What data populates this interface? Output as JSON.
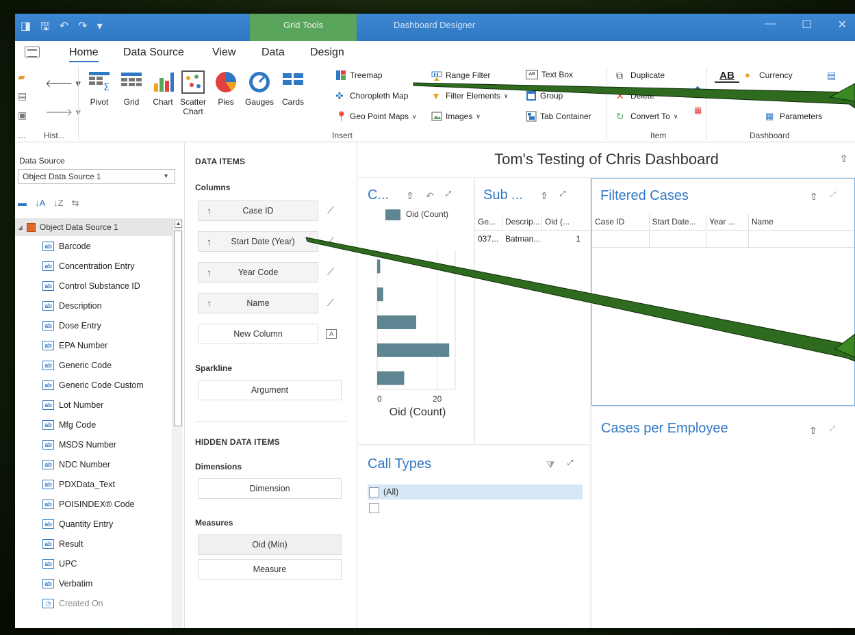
{
  "titlebar": {
    "context_tab": "Grid Tools",
    "title": "Dashboard Designer"
  },
  "tabs": [
    "Home",
    "Data Source",
    "View",
    "Data",
    "Design"
  ],
  "ribbon": {
    "history_group": "Hist...",
    "insert_group": "Insert",
    "item_group": "Item",
    "dashboard_group": "Dashboard",
    "big_buttons": {
      "pivot": "Pivot",
      "grid": "Grid",
      "chart": "Chart",
      "scatter_line1": "Scatter",
      "scatter_line2": "Chart",
      "pies": "Pies",
      "gauges": "Gauges",
      "cards": "Cards"
    },
    "small_buttons": {
      "treemap": "Treemap",
      "choropleth": "Choropleth Map",
      "geo_point": "Geo Point Maps",
      "range_filter": "Range Filter",
      "filter_elements": "Filter Elements",
      "images": "Images",
      "text_box": "Text Box",
      "group": "Group",
      "tab_container": "Tab Container",
      "duplicate": "Duplicate",
      "delete": "Delete",
      "convert_to": "Convert To",
      "title": "Title",
      "title_icon": "AB",
      "currency": "Currency",
      "parameters": "Parameters"
    }
  },
  "data_source": {
    "label": "Data Source",
    "selected": "Object Data Source 1",
    "root": "Object Data Source 1",
    "fields": [
      "Barcode",
      "Concentration Entry",
      "Control Substance ID",
      "Description",
      "Dose Entry",
      "EPA Number",
      "Generic Code",
      "Generic Code Custom",
      "Lot Number",
      "Mfg Code",
      "MSDS Number",
      "NDC Number",
      "PDXData_Text",
      "POISINDEX® Code",
      "Quantity Entry",
      "Result",
      "UPC",
      "Verbatim"
    ],
    "last_field": "Created On"
  },
  "data_items": {
    "header": "DATA ITEMS",
    "columns_label": "Columns",
    "columns": [
      "Case ID",
      "Start Date (Year)",
      "Year Code",
      "Name"
    ],
    "new_column": "New Column",
    "sparkline_label": "Sparkline",
    "sparkline_arg": "Argument",
    "hidden_header": "HIDDEN DATA ITEMS",
    "dimensions_label": "Dimensions",
    "dimension": "Dimension",
    "measures_label": "Measures",
    "measures": [
      "Oid (Min)",
      "Measure"
    ]
  },
  "dashboard": {
    "title": "Tom's Testing of Chris Dashboard",
    "chart_card": {
      "title": "C...",
      "legend": "Oid (Count)",
      "axis_title": "Oid (Count)",
      "ticks": [
        "0",
        "20"
      ]
    },
    "sub_card": {
      "title": "Sub ...",
      "headers": [
        "Ge...",
        "Descrip...",
        "Oid (..."
      ],
      "row": [
        "037...",
        "Batman...",
        "1"
      ]
    },
    "filtered": {
      "title": "Filtered Cases",
      "headers": [
        "Case ID",
        "Start Date...",
        "Year ...",
        "Name"
      ]
    },
    "cases_per_employee": {
      "title": "Cases per Employee"
    },
    "call_types": {
      "title": "Call Types",
      "all": "(All)"
    }
  },
  "chart_data": {
    "type": "bar",
    "orientation": "horizontal",
    "categories": [
      "",
      "",
      "",
      "",
      ""
    ],
    "series": [
      {
        "name": "Oid (Count)",
        "values": [
          1,
          2,
          13,
          24,
          9
        ]
      }
    ],
    "xlabel": "Oid (Count)",
    "xlim": [
      0,
      26
    ],
    "xticks": [
      0,
      20
    ],
    "grid": true,
    "legend": "top",
    "colors": [
      "#5d8592"
    ]
  },
  "colors": {
    "accent": "#2f78c4",
    "context_tab": "#5aa55c",
    "arrow": "#2e6b1f"
  }
}
